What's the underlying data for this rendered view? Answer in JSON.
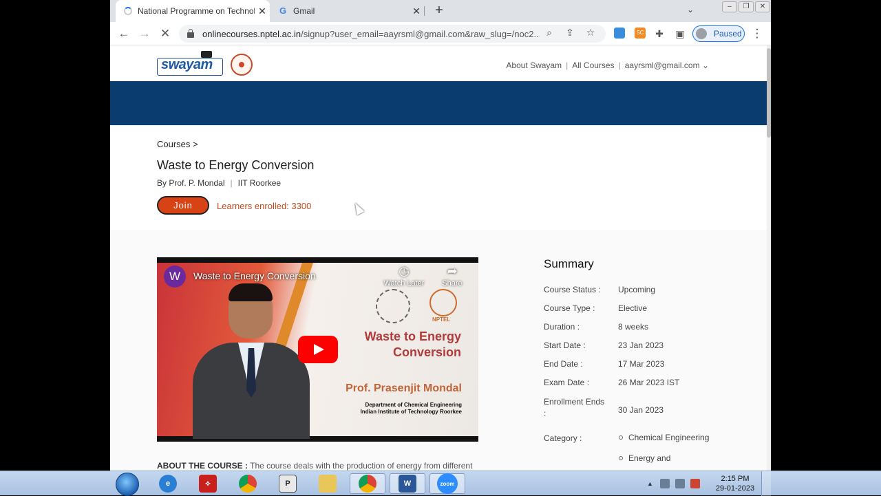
{
  "browser": {
    "tabs": [
      {
        "title": "National Programme on Technolog",
        "close": "✕"
      },
      {
        "title": "Gmail",
        "close": "✕"
      }
    ],
    "new_tab": "+",
    "url_host": "onlinecourses.nptel.ac.in",
    "url_path": "/signup?user_email=aayrsml@gmail.com&raw_slug=/noc2...",
    "profile_status": "Paused"
  },
  "site": {
    "logo_text": "swayam",
    "nav": {
      "about": "About Swayam",
      "sep1": "|",
      "courses": "All Courses",
      "sep2": "|",
      "user": "aayrsml@gmail.com",
      "user_caret": "⌄"
    }
  },
  "course": {
    "breadcrumb": "Courses  >",
    "title": "Waste to Energy Conversion",
    "instructor": "By Prof. P. Mondal",
    "by_sep": "|",
    "institute": "IIT Roorkee",
    "join_label": "Join",
    "learners": "Learners enrolled: 3300"
  },
  "video": {
    "channel_letter": "W",
    "title": "Waste to Energy Conversion",
    "watch_later": "Watch Later",
    "share": "Share",
    "nptel_label": "NPTEL",
    "slide_title": "Waste to Energy Conversion",
    "professor": "Prof. Prasenjit Mondal",
    "department": "Department of Chemical Engineering",
    "institute_full": "Indian Institute of Technology Roorkee"
  },
  "about": {
    "label": "ABOUT THE COURSE :",
    "text": " The course deals with the production of energy from different"
  },
  "summary": {
    "heading": "Summary",
    "rows": [
      {
        "key": "Course Status :",
        "value": "Upcoming"
      },
      {
        "key": "Course Type :",
        "value": "Elective"
      },
      {
        "key": "Duration :",
        "value": "8 weeks"
      },
      {
        "key": "Start Date :",
        "value": "23 Jan 2023"
      },
      {
        "key": "End Date :",
        "value": "17 Mar 2023"
      },
      {
        "key": "Exam Date :",
        "value": "26 Mar 2023 IST"
      },
      {
        "key": "Enrollment Ends :",
        "value": "30 Jan 2023"
      },
      {
        "key": "Category :",
        "values": [
          "Chemical Engineering",
          "Energy and"
        ]
      }
    ]
  },
  "taskbar": {
    "word_label": "W",
    "zoom_label": "zoom",
    "time": "2:15 PM",
    "date": "29-01-2023"
  }
}
